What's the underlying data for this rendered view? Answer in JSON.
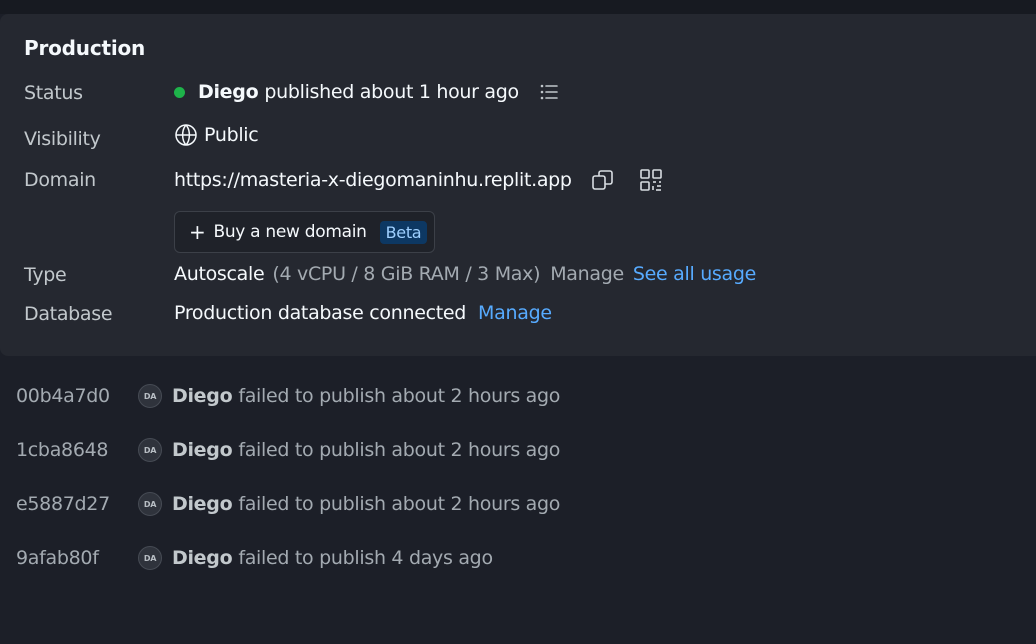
{
  "production": {
    "title": "Production",
    "status": {
      "label": "Status",
      "user": "Diego",
      "text": "published about 1 hour ago",
      "color": "#1eb34a"
    },
    "visibility": {
      "label": "Visibility",
      "value": "Public"
    },
    "domain": {
      "label": "Domain",
      "url": "https://masteria-x-diegomaninhu.replit.app",
      "buy_label": "Buy a new domain",
      "beta_badge": "Beta"
    },
    "type": {
      "label": "Type",
      "value": "Autoscale",
      "specs": "(4 vCPU / 8 GiB RAM / 3 Max)",
      "manage_label": "Manage",
      "usage_link": "See all usage"
    },
    "database": {
      "label": "Database",
      "value": "Production database connected",
      "manage_link": "Manage"
    }
  },
  "history": [
    {
      "hash": "00b4a7d0",
      "avatar": "DA",
      "user": "Diego",
      "message": "failed to publish about 2 hours ago"
    },
    {
      "hash": "1cba8648",
      "avatar": "DA",
      "user": "Diego",
      "message": "failed to publish about 2 hours ago"
    },
    {
      "hash": "e5887d27",
      "avatar": "DA",
      "user": "Diego",
      "message": "failed to publish about 2 hours ago"
    },
    {
      "hash": "9afab80f",
      "avatar": "DA",
      "user": "Diego",
      "message": "failed to publish 4 days ago"
    }
  ],
  "colors": {
    "link": "#57abff",
    "background": "#1c1f28",
    "card": "#252830"
  },
  "icons": {
    "status": "list-icon",
    "visibility": "globe-icon",
    "copy": "copy-icon",
    "qr": "qr-code-icon",
    "plus": "plus-icon"
  }
}
